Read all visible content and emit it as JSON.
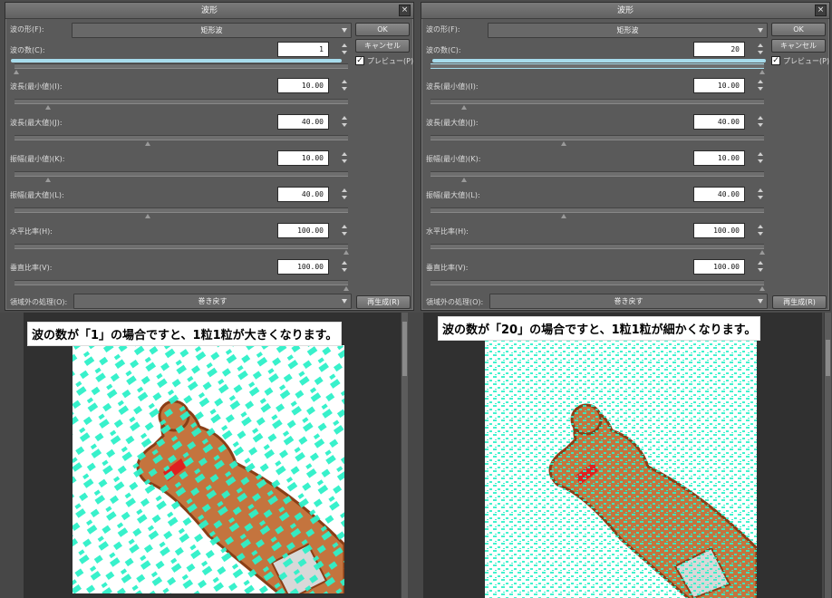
{
  "left": {
    "title": "波形",
    "close": "×",
    "wave_shape_label": "波の形(F):",
    "wave_shape_value": "矩形波",
    "ok": "OK",
    "cancel": "キャンセル",
    "preview_label": "プレビュー(P)",
    "preview_check": "✓",
    "wave_count_label": "波の数(C):",
    "wave_count_value": "1",
    "wavelength_min_label": "波長(最小値)(I):",
    "wavelength_min_value": "10.00",
    "wavelength_max_label": "波長(最大値)(J):",
    "wavelength_max_value": "40.00",
    "amplitude_min_label": "振幅(最小値)(K):",
    "amplitude_min_value": "10.00",
    "amplitude_max_label": "振幅(最大値)(L):",
    "amplitude_max_value": "40.00",
    "horizontal_ratio_label": "水平比率(H):",
    "horizontal_ratio_value": "100.00",
    "vertical_ratio_label": "垂直比率(V):",
    "vertical_ratio_value": "100.00",
    "outside_label": "領域外の処理(O):",
    "outside_value": "巻き戻す",
    "regen": "再生成(R)",
    "caption": "波の数が「1」の場合ですと、1粒1粒が大きくなります。"
  },
  "right": {
    "title": "波形",
    "close": "×",
    "wave_shape_label": "波の形(F):",
    "wave_shape_value": "矩形波",
    "ok": "OK",
    "cancel": "キャンセル",
    "preview_label": "プレビュー(P)",
    "preview_check": "✓",
    "wave_count_label": "波の数(C):",
    "wave_count_value": "20",
    "wavelength_min_label": "波長(最小値)(I):",
    "wavelength_min_value": "10.00",
    "wavelength_max_label": "波長(最大値)(J):",
    "wavelength_max_value": "40.00",
    "amplitude_min_label": "振幅(最小値)(K):",
    "amplitude_min_value": "10.00",
    "amplitude_max_label": "振幅(最大値)(L):",
    "amplitude_max_value": "40.00",
    "horizontal_ratio_label": "水平比率(H):",
    "horizontal_ratio_value": "100.00",
    "vertical_ratio_label": "垂直比率(V):",
    "vertical_ratio_value": "100.00",
    "outside_label": "領域外の処理(O):",
    "outside_value": "巻き戻す",
    "regen": "再生成(R)",
    "caption": "波の数が「20」の場合ですと、1粒1粒が細かくなります。"
  },
  "colors": {
    "dialog_bg": "#5a5a5a",
    "highlight": "#a7dcec",
    "noise": "#2ef0c8",
    "bear_fill": "#c4743e",
    "bear_outline": "#8a3e16",
    "ribbon": "#e02020"
  }
}
